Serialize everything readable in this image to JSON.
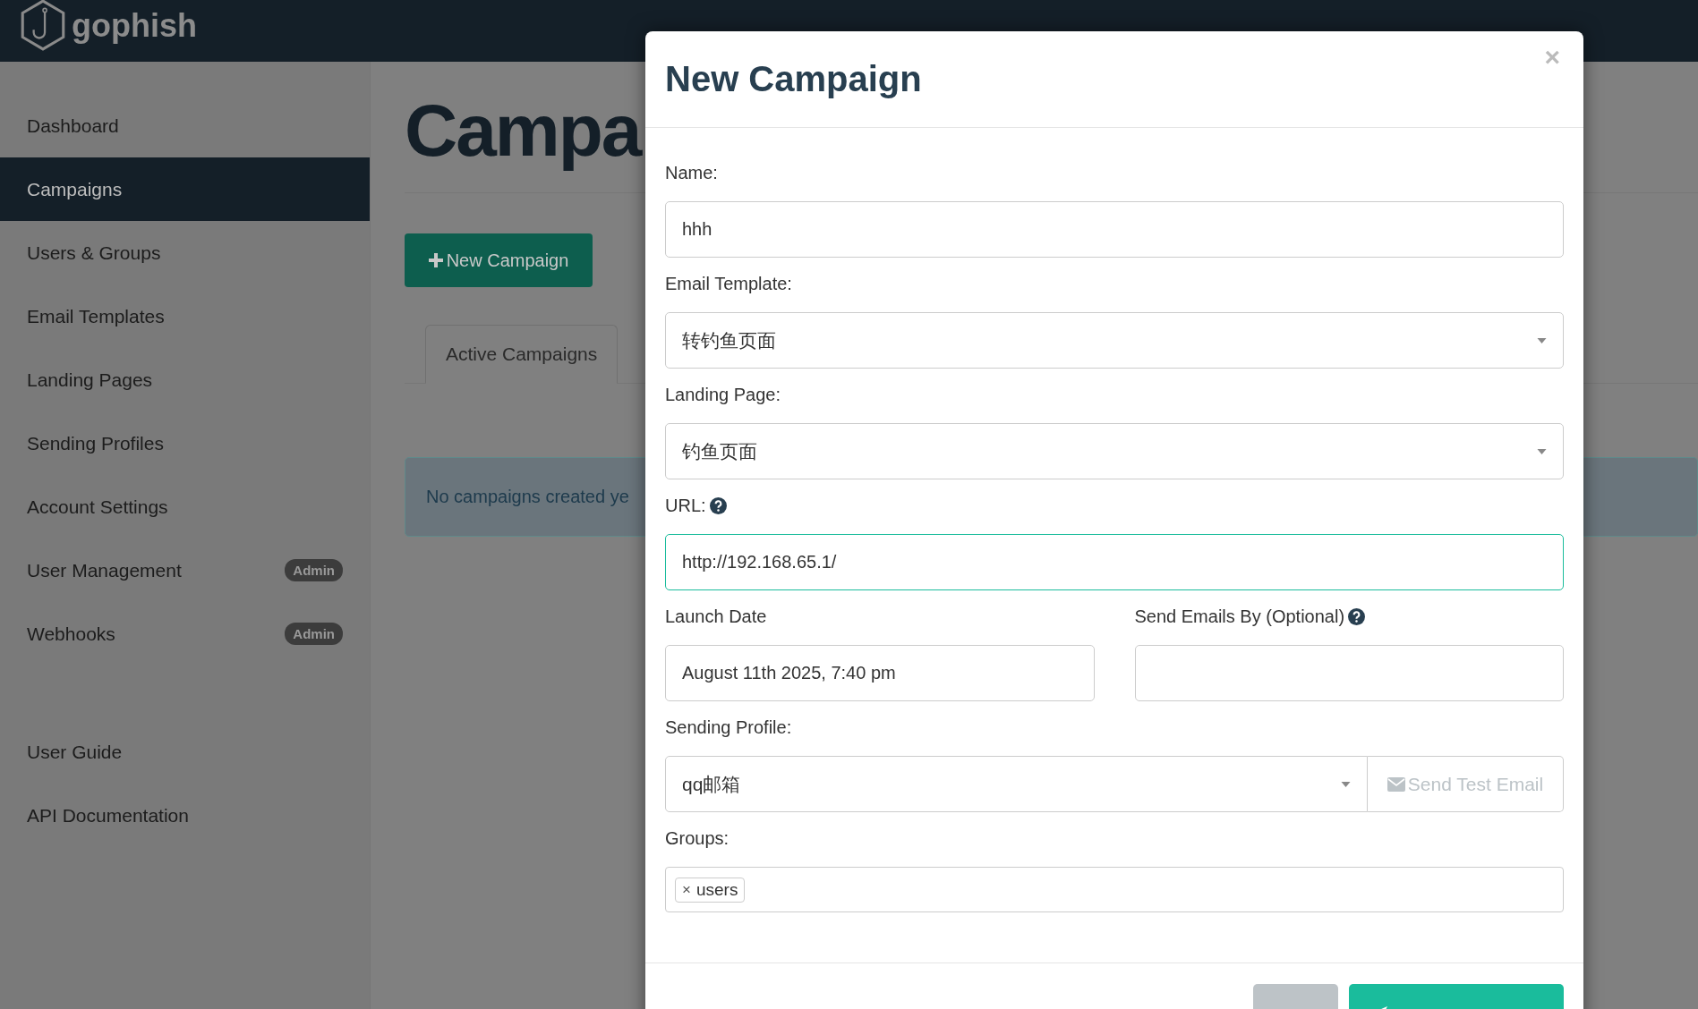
{
  "navbar": {
    "brand": "gophish"
  },
  "sidebar": {
    "items": [
      {
        "label": "Dashboard",
        "selected": false
      },
      {
        "label": "Campaigns",
        "selected": true
      },
      {
        "label": "Users & Groups",
        "selected": false
      },
      {
        "label": "Email Templates",
        "selected": false
      },
      {
        "label": "Landing Pages",
        "selected": false
      },
      {
        "label": "Sending Profiles",
        "selected": false
      },
      {
        "label": "Account Settings",
        "selected": false
      },
      {
        "label": "User Management",
        "selected": false,
        "badge": "Admin"
      },
      {
        "label": "Webhooks",
        "selected": false,
        "badge": "Admin"
      }
    ],
    "help_items": [
      {
        "label": "User Guide"
      },
      {
        "label": "API Documentation"
      }
    ]
  },
  "page": {
    "title": "Campa",
    "new_button": "New Campaign",
    "tabs": [
      {
        "label": "Active Campaigns",
        "selected": true
      }
    ],
    "alert": "No campaigns created ye"
  },
  "modal": {
    "title": "New Campaign",
    "close": "×",
    "fields": [
      {
        "kind": "text",
        "label": "Name:",
        "value": "hhh",
        "focused": false
      },
      {
        "kind": "select",
        "label": "Email Template:",
        "value": "转钓鱼页面"
      },
      {
        "kind": "select",
        "label": "Landing Page:",
        "value": "钓鱼页面"
      },
      {
        "kind": "text",
        "label": "URL:",
        "help": true,
        "value": "http://192.168.65.1/",
        "focused": true
      },
      {
        "kind": "pair",
        "items": [
          {
            "label": "Launch Date",
            "value": "August 11th 2025, 7:40 pm"
          },
          {
            "label": "Send Emails By (Optional)",
            "help": true
          }
        ]
      },
      {
        "kind": "select",
        "label": "Sending Profile:",
        "value": "qq邮箱",
        "button": "Send Test Email"
      },
      {
        "kind": "tags",
        "label": "Groups:",
        "tags": [
          {
            "label": "users",
            "remove": "×"
          }
        ]
      }
    ],
    "buttons": [
      {
        "kind": "secondary"
      },
      {
        "kind": "primary"
      }
    ]
  }
}
